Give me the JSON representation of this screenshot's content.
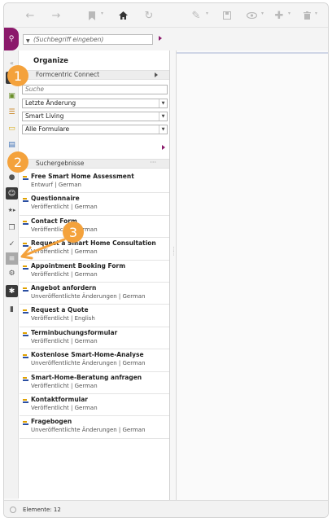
{
  "search": {
    "placeholder": "(Suchbegriff eingeben)"
  },
  "panel": {
    "title": "Organize",
    "section_connect": "Formcentric Connect",
    "search_field_placeholder": "Suche",
    "filter_sort": "Letzte Änderung",
    "filter_site": "Smart Living",
    "filter_type": "Alle Formulare",
    "results_label": "Suchergebnisse",
    "results_more": "···"
  },
  "results": [
    {
      "name": "Free Smart Home Assessment",
      "meta": "Entwurf | German"
    },
    {
      "name": "Questionnaire",
      "meta": "Veröffentlicht | German"
    },
    {
      "name": "Contact Form",
      "meta": "Veröffentlicht | German"
    },
    {
      "name": "Request a Smart Home Consultation",
      "meta": "Veröffentlicht | German"
    },
    {
      "name": "Appointment Booking Form",
      "meta": "Veröffentlicht | German"
    },
    {
      "name": "Angebot anfordern",
      "meta": "Unveröffentlichte Änderungen | German"
    },
    {
      "name": "Request a Quote",
      "meta": "Veröffentlicht | English"
    },
    {
      "name": "Terminbuchungsformular",
      "meta": "Veröffentlicht | German"
    },
    {
      "name": "Kostenlose Smart-Home-Analyse",
      "meta": "Unveröffentlichte Änderungen | German"
    },
    {
      "name": "Smart-Home-Beratung anfragen",
      "meta": "Veröffentlicht | German"
    },
    {
      "name": "Kontaktformular",
      "meta": "Veröffentlicht | German"
    },
    {
      "name": "Fragebogen",
      "meta": "Unveröffentlichte Änderungen | German"
    }
  ],
  "status": {
    "count_text": "Elemente: 12"
  },
  "badges": {
    "one": "1",
    "two": "2",
    "three": "3"
  },
  "colors": {
    "accent": "#8b1a6b",
    "badge": "#f4a23c"
  },
  "icons": [
    "back-icon",
    "forward-icon",
    "bookmark-icon",
    "home-icon",
    "reload-icon",
    "edit-icon",
    "save-icon",
    "preview-icon",
    "add-icon",
    "delete-icon",
    "search-icon"
  ]
}
